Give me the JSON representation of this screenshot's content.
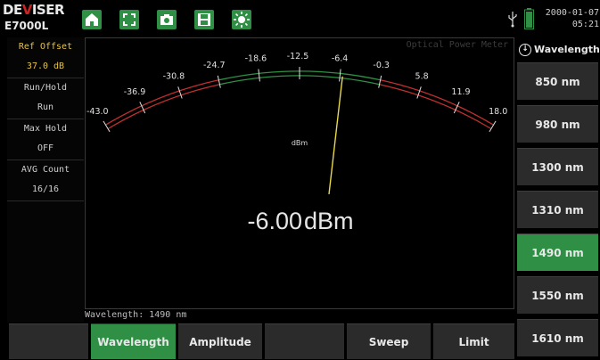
{
  "device": {
    "brand_prefix": "DE",
    "brand_v": "V",
    "brand_suffix": "ISER",
    "model": "E7000L"
  },
  "toolbar": {
    "icons": [
      "home-icon",
      "fullscreen-icon",
      "camera-icon",
      "save-icon",
      "brightness-icon"
    ],
    "accent": "#2f8f45"
  },
  "status": {
    "date": "2000-01-07",
    "time": "05:21",
    "usb_icon": "usb-icon",
    "battery_icon": "battery-icon"
  },
  "left_panel": [
    {
      "label": "Ref Offset",
      "value": "37.0 dB",
      "highlight": true
    },
    {
      "label": "Run/Hold",
      "value": "Run",
      "highlight": false
    },
    {
      "label": "Max Hold",
      "value": "OFF",
      "highlight": false
    },
    {
      "label": "AVG Count",
      "value": "16/16",
      "highlight": false
    }
  ],
  "plot": {
    "title": "Optical Power Meter",
    "unit_label": "dBm",
    "reading_value": "-6.00",
    "reading_unit": "dBm",
    "needle_value": -6.0,
    "scale_min": -43.0,
    "scale_max": 18.0,
    "ticks": [
      "-43.0",
      "-36.9",
      "-30.8",
      "-24.7",
      "-18.6",
      "-12.5",
      "-6.4",
      "-0.3",
      "5.8",
      "11.9",
      "18.0"
    ],
    "colors": {
      "arc_red": "#c03030",
      "arc_green": "#2f8f45",
      "needle": "#e8d84a"
    }
  },
  "status_line": "Wavelength: 1490 nm",
  "right_panel": {
    "header": "Wavelength",
    "header_icon": "circle-arrow-down-icon",
    "buttons": [
      "850 nm",
      "980 nm",
      "1300 nm",
      "1310 nm",
      "1490 nm",
      "1550 nm",
      "1610 nm"
    ],
    "active_index": 4
  },
  "bottom_bar": {
    "buttons": [
      "",
      "Wavelength",
      "Amplitude",
      "",
      "Sweep",
      "Limit"
    ],
    "active_index": 1
  }
}
